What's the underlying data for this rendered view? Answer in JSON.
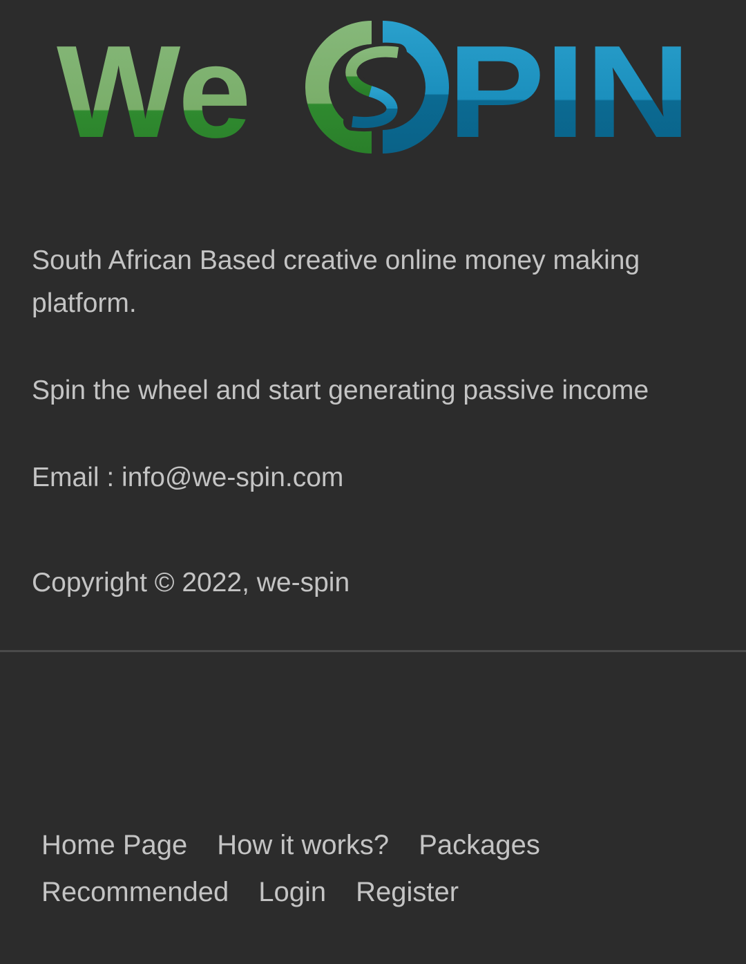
{
  "brand": {
    "logo_text": "WeSPIN",
    "logo_part_we": "We",
    "logo_part_spin": "SPIN",
    "green_light": "#7cb36b",
    "green_dark": "#2e8b2e",
    "blue_light": "#1f97c4",
    "blue_dark": "#0e6f96"
  },
  "about": {
    "description": "South African Based creative online money making platform.",
    "tagline": "Spin the wheel and start generating passive income",
    "email_line": "Email : info@we-spin.com",
    "copyright": "Copyright © 2022, we-spin"
  },
  "footer_nav": {
    "home": "Home Page",
    "how_it_works": "How it works?",
    "packages": "Packages",
    "recommended": "Recommended",
    "login": "Login",
    "register": "Register"
  },
  "colors": {
    "background": "#2c2c2c",
    "text": "#c4c4c4",
    "divider": "#4a4a4a"
  }
}
